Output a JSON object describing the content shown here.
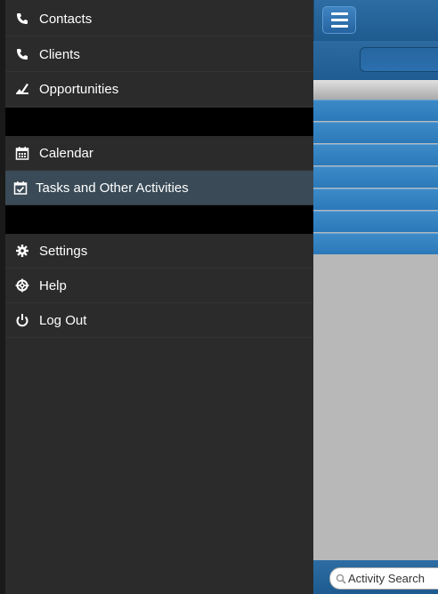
{
  "nav": {
    "contacts": "Contacts",
    "clients": "Clients",
    "opportunities": "Opportunities",
    "calendar": "Calendar",
    "tasks": "Tasks and Other Activities",
    "settings": "Settings",
    "help": "Help",
    "logout": "Log Out"
  },
  "app": {
    "search_placeholder": "Activity Search"
  },
  "colors": {
    "nav_bg": "#2b2b2b",
    "nav_active": "#3a4b57",
    "header_blue": "#1e5b8f"
  }
}
